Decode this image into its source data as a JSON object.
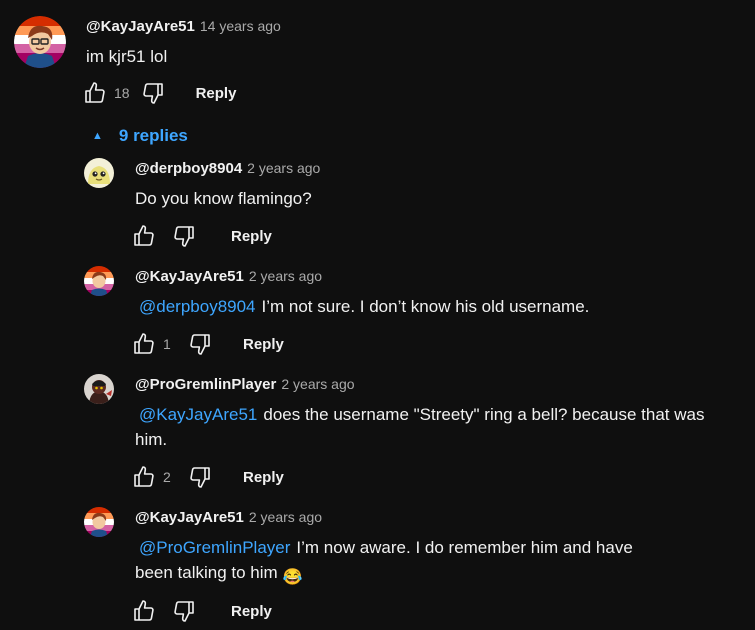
{
  "top_comment": {
    "author": "@KayJayAre51",
    "time": "14 years ago",
    "text": "im kjr51 lol",
    "likes": "18",
    "reply_label": "Reply"
  },
  "replies_toggle": {
    "label": "9 replies",
    "caret": "▲"
  },
  "replies": [
    {
      "author": "@derpboy8904",
      "time": "2 years ago",
      "mention": "",
      "text": "Do you know flamingo?",
      "likes": "",
      "reply_label": "Reply"
    },
    {
      "author": "@KayJayAre51",
      "time": "2 years ago",
      "mention": "@derpboy8904",
      "text": "I’m not sure. I don’t know his old username.",
      "likes": "1",
      "reply_label": "Reply"
    },
    {
      "author": "@ProGremlinPlayer",
      "time": "2 years ago",
      "mention": "@KayJayAre51",
      "text": "does the username \"Streety\" ring a bell? because that was him.",
      "likes": "2",
      "reply_label": "Reply"
    },
    {
      "author": "@KayJayAre51",
      "time": "2 years ago",
      "mention": "@ProGremlinPlayer",
      "text": "I’m now aware. I do remember him and have been talking to him",
      "emoji": "😂",
      "likes": "",
      "reply_label": "Reply"
    }
  ],
  "colors": {
    "background": "#0f0f0f",
    "link": "#3ea6ff",
    "muted": "#aaaaaa",
    "text": "#f1f1f1"
  },
  "icons": [
    "thumbs-up-icon",
    "thumbs-down-icon",
    "caret-up-icon",
    "laughing-emoji-icon"
  ]
}
